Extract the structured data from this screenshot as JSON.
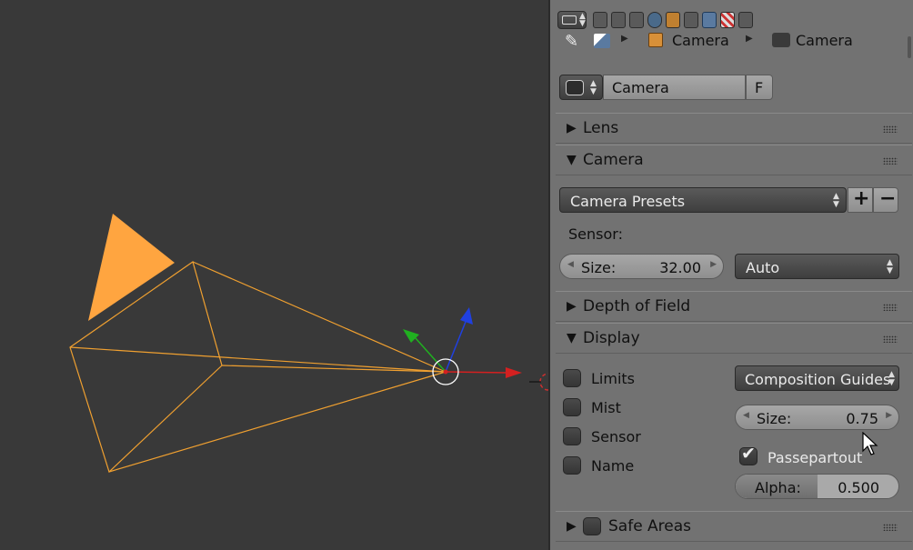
{
  "breadcrumb": {
    "object_name": "Camera",
    "data_name": "Camera"
  },
  "datablock": {
    "name": "Camera",
    "fake_user_label": "F"
  },
  "panels": {
    "lens": "Lens",
    "camera": "Camera",
    "dof": "Depth of Field",
    "display": "Display",
    "safe_areas": "Safe Areas"
  },
  "camera_panel": {
    "presets_label": "Camera Presets",
    "add_label": "+",
    "remove_label": "−",
    "sensor_label": "Sensor:",
    "size_label": "Size:",
    "size_value": "32.00",
    "fit_value": "Auto"
  },
  "display_panel": {
    "checkboxes": [
      "Limits",
      "Mist",
      "Sensor",
      "Name"
    ],
    "guides_label": "Composition Guides",
    "size_label": "Size:",
    "size_value": "0.75",
    "passepartout_label": "Passepartout",
    "passepartout_checked": true,
    "alpha_label": "Alpha:",
    "alpha_value": "0.500",
    "alpha_fraction": 0.5
  },
  "colors": {
    "camera_wire": "#f0a030",
    "camera_triangle": "#ffa540",
    "gizmo_x": "#d42020",
    "gizmo_y": "#20b020",
    "gizmo_z": "#2040e0",
    "panel_bg": "#727272",
    "viewport_bg": "#393939"
  }
}
